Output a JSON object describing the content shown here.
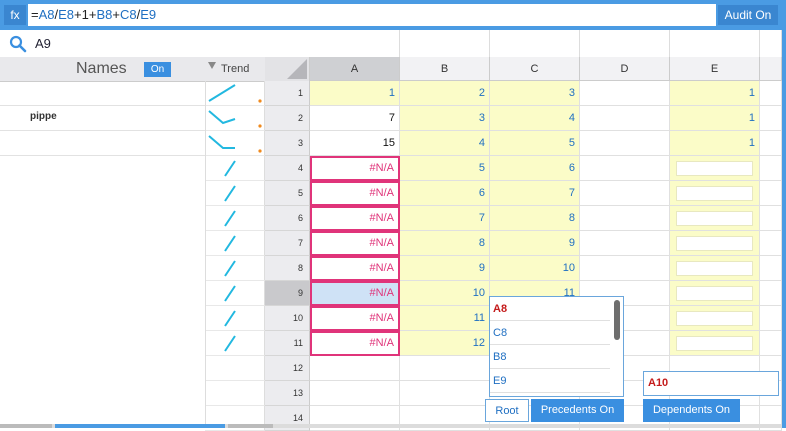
{
  "formula_bar": {
    "fx_label": "fx",
    "formula_parts": [
      {
        "t": "=",
        "ref": false
      },
      {
        "t": "A8",
        "ref": true
      },
      {
        "t": "/",
        "ref": false
      },
      {
        "t": "E8",
        "ref": true
      },
      {
        "t": "+1+",
        "ref": false
      },
      {
        "t": "B8",
        "ref": true
      },
      {
        "t": "+",
        "ref": false
      },
      {
        "t": "C8",
        "ref": true
      },
      {
        "t": "/",
        "ref": false
      },
      {
        "t": "E9",
        "ref": true
      }
    ],
    "audit_label": "Audit On"
  },
  "search": {
    "value": "A9"
  },
  "names_panel": {
    "title": "Names",
    "toggle_label": "On",
    "trend_label": "Trend",
    "names": [
      "",
      "pippe",
      ""
    ]
  },
  "columns": [
    "A",
    "B",
    "C",
    "D",
    "E"
  ],
  "selected_column": "A",
  "selected_row": "9",
  "rows": [
    {
      "n": "1",
      "A": "1",
      "B": "2",
      "C": "3",
      "D": "",
      "E": "1"
    },
    {
      "n": "2",
      "A": "7",
      "B": "3",
      "C": "4",
      "D": "",
      "E": "1"
    },
    {
      "n": "3",
      "A": "15",
      "B": "4",
      "C": "5",
      "D": "",
      "E": "1"
    },
    {
      "n": "4",
      "A": "#N/A",
      "B": "5",
      "C": "6",
      "D": "",
      "E": ""
    },
    {
      "n": "5",
      "A": "#N/A",
      "B": "6",
      "C": "7",
      "D": "",
      "E": ""
    },
    {
      "n": "6",
      "A": "#N/A",
      "B": "7",
      "C": "8",
      "D": "",
      "E": ""
    },
    {
      "n": "7",
      "A": "#N/A",
      "B": "8",
      "C": "9",
      "D": "",
      "E": ""
    },
    {
      "n": "8",
      "A": "#N/A",
      "B": "9",
      "C": "10",
      "D": "",
      "E": ""
    },
    {
      "n": "9",
      "A": "#N/A",
      "B": "10",
      "C": "11",
      "D": "",
      "E": ""
    },
    {
      "n": "10",
      "A": "#N/A",
      "B": "11",
      "C": "",
      "D": "",
      "E": ""
    },
    {
      "n": "11",
      "A": "#N/A",
      "B": "12",
      "C": "",
      "D": "",
      "E": ""
    },
    {
      "n": "12",
      "A": "",
      "B": "",
      "C": "",
      "D": "",
      "E": ""
    },
    {
      "n": "13",
      "A": "",
      "B": "",
      "C": "",
      "D": "",
      "E": ""
    },
    {
      "n": "14",
      "A": "",
      "B": "",
      "C": "",
      "D": "",
      "E": ""
    }
  ],
  "precedents_popup": {
    "items": [
      "A8",
      "C8",
      "B8",
      "E9"
    ]
  },
  "dependents_box": {
    "value": "A10"
  },
  "buttons": {
    "root": "Root",
    "precedents": "Precedents On",
    "dependents": "Dependents On"
  },
  "colors": {
    "accent": "#4a9be3",
    "highlight_yellow": "#fbfcc8",
    "error_pink": "#e0347a",
    "ref_blue": "#1f6fc2",
    "trend_line": "#22b8e0",
    "trend_dot": "#f08a1e"
  }
}
